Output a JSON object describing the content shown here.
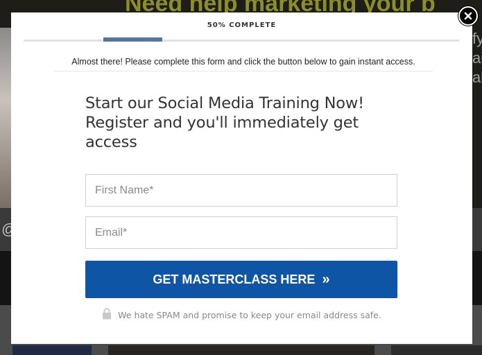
{
  "background": {
    "headline": "Need help marketing your b",
    "side_text": "fy\nai\nali"
  },
  "modal": {
    "progress": {
      "label": "50% COMPLETE",
      "percent": 0.5
    },
    "subheading": "Almost there! Please complete this form and click the button below to gain instant access.",
    "title": "Start our Social Media Training Now! Register and you'll immediately get access",
    "fields": {
      "first_name": {
        "placeholder": "First Name*",
        "value": ""
      },
      "email": {
        "placeholder": "Email*",
        "value": ""
      }
    },
    "cta": {
      "label": "GET MASTERCLASS HERE",
      "chevron": "»"
    },
    "spam_note": "We hate SPAM and promise to keep your email address safe.",
    "close": {
      "icon": "close-icon",
      "glyph": "×"
    }
  },
  "colors": {
    "cta": "#0e55a6",
    "progress_fill": "#55779f",
    "overlay": "#2b2b2b"
  }
}
